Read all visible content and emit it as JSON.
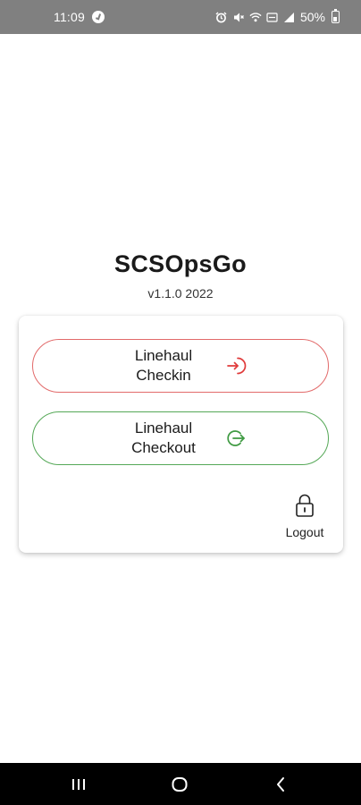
{
  "status_bar": {
    "time": "11:09",
    "battery": "50%",
    "icons": [
      "alarm-icon",
      "mute-icon",
      "wifi-icon",
      "volte-icon",
      "signal-icon",
      "battery-icon"
    ]
  },
  "app": {
    "title": "SCSOpsGo",
    "version": "v1.1.0 2022"
  },
  "actions": {
    "checkin": {
      "line1": "Linehaul",
      "line2": "Checkin",
      "icon": "login-icon",
      "color": "#e03b3b"
    },
    "checkout": {
      "line1": "Linehaul",
      "line2": "Checkout",
      "icon": "logout-arrow-icon",
      "color": "#3f9a42"
    }
  },
  "logout": {
    "label": "Logout",
    "icon": "lock-icon"
  },
  "nav": {
    "buttons": [
      "recent-apps",
      "home",
      "back"
    ]
  }
}
